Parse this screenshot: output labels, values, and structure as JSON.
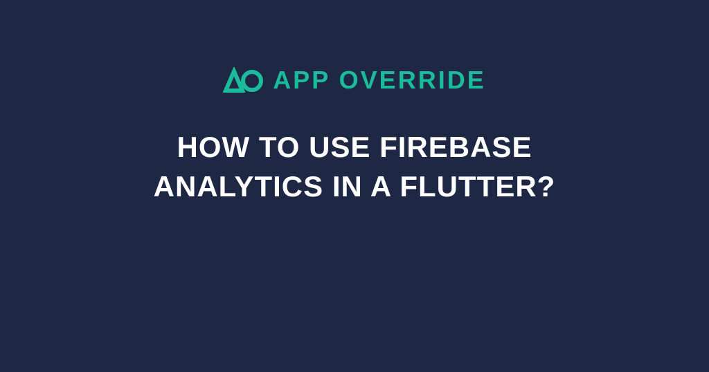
{
  "brand": {
    "name": "APP OVERRIDE",
    "accent_color": "#1bbc9b"
  },
  "heading": "How to use Firebase Analytics in a Flutter?",
  "colors": {
    "background": "#1e2744",
    "text": "#ffffff"
  }
}
